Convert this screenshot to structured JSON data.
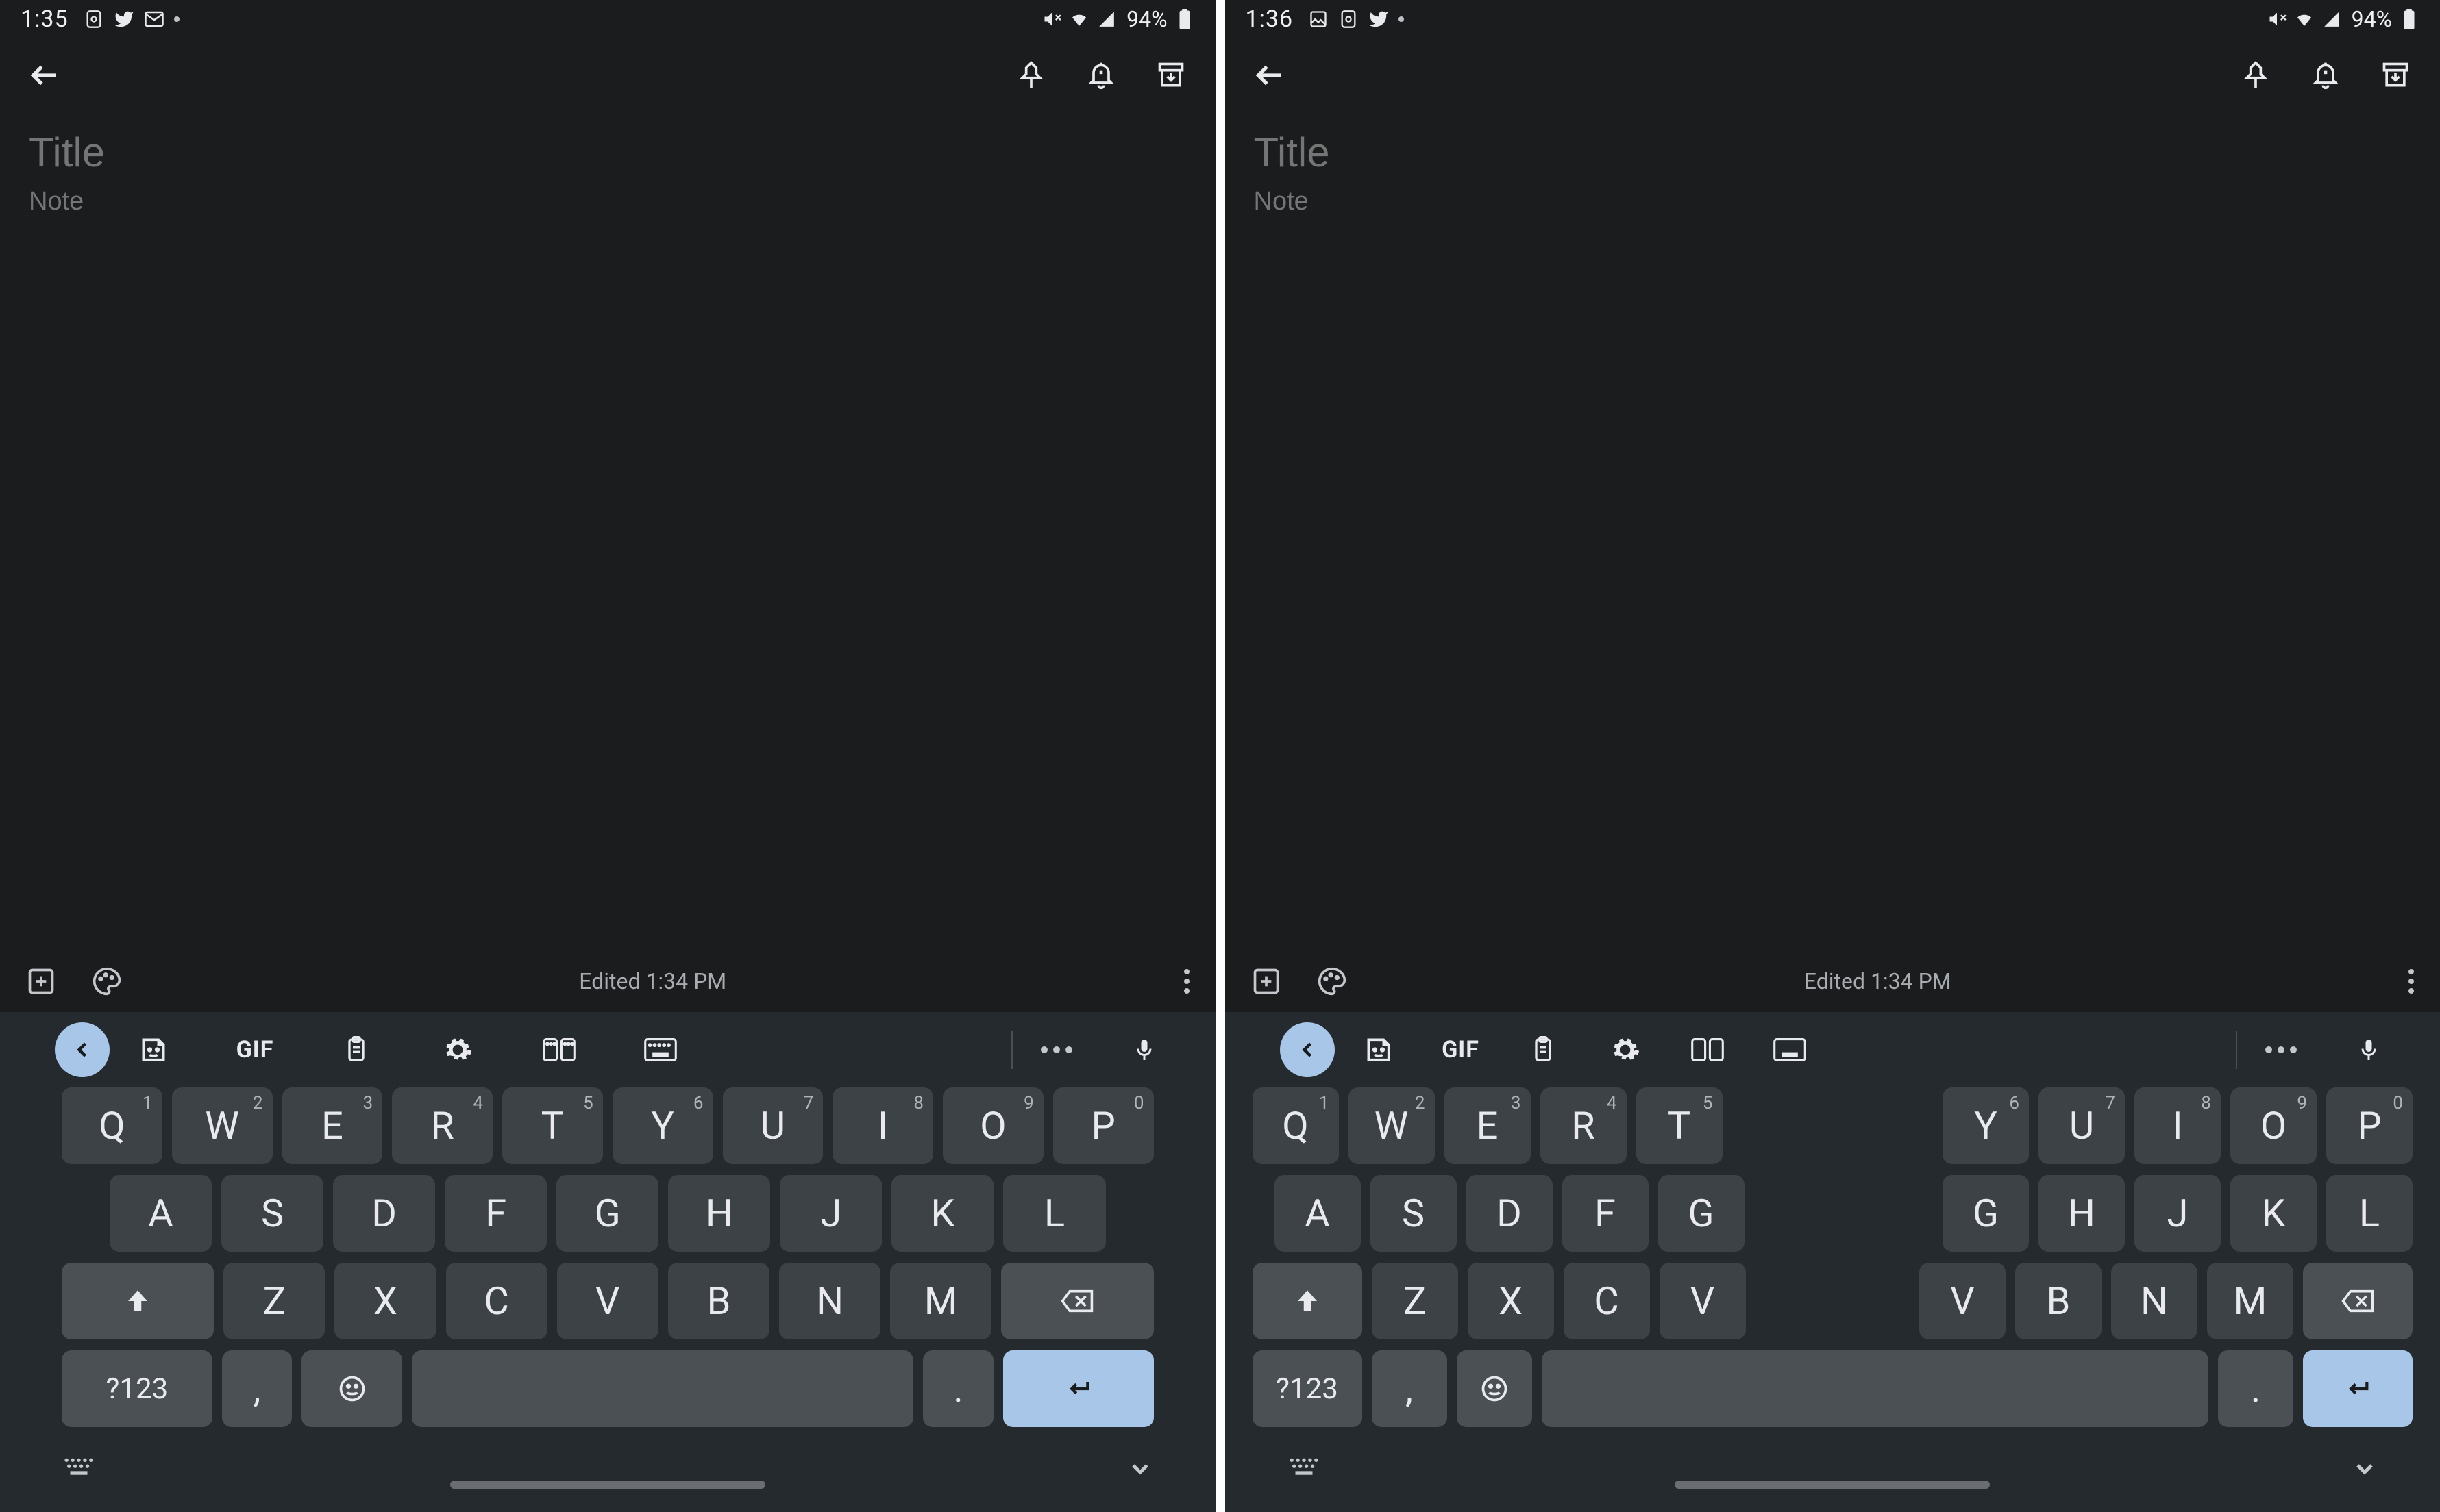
{
  "panes": [
    {
      "status": {
        "time": "1:35",
        "battery": "94%"
      },
      "note": {
        "title_placeholder": "Title",
        "body_placeholder": "Note",
        "edited": "Edited 1:34 PM"
      },
      "keyboard": {
        "layout": "standard",
        "suggest_gif": "GIF",
        "row1": [
          {
            "k": "Q",
            "s": "1"
          },
          {
            "k": "W",
            "s": "2"
          },
          {
            "k": "E",
            "s": "3"
          },
          {
            "k": "R",
            "s": "4"
          },
          {
            "k": "T",
            "s": "5"
          },
          {
            "k": "Y",
            "s": "6"
          },
          {
            "k": "U",
            "s": "7"
          },
          {
            "k": "I",
            "s": "8"
          },
          {
            "k": "O",
            "s": "9"
          },
          {
            "k": "P",
            "s": "0"
          }
        ],
        "row2": [
          "A",
          "S",
          "D",
          "F",
          "G",
          "H",
          "J",
          "K",
          "L"
        ],
        "row3": [
          "Z",
          "X",
          "C",
          "V",
          "B",
          "N",
          "M"
        ],
        "sym_label": "?123",
        "comma": ",",
        "period": "."
      }
    },
    {
      "status": {
        "time": "1:36",
        "battery": "94%"
      },
      "note": {
        "title_placeholder": "Title",
        "body_placeholder": "Note",
        "edited": "Edited 1:34 PM"
      },
      "keyboard": {
        "layout": "split",
        "suggest_gif": "GIF",
        "left": {
          "row1": [
            {
              "k": "Q",
              "s": "1"
            },
            {
              "k": "W",
              "s": "2"
            },
            {
              "k": "E",
              "s": "3"
            },
            {
              "k": "R",
              "s": "4"
            },
            {
              "k": "T",
              "s": "5"
            }
          ],
          "row2": [
            "A",
            "S",
            "D",
            "F",
            "G"
          ],
          "row3": [
            "Z",
            "X",
            "C",
            "V"
          ]
        },
        "right": {
          "row1": [
            {
              "k": "Y",
              "s": "6"
            },
            {
              "k": "U",
              "s": "7"
            },
            {
              "k": "I",
              "s": "8"
            },
            {
              "k": "O",
              "s": "9"
            },
            {
              "k": "P",
              "s": "0"
            }
          ],
          "row2": [
            "G",
            "H",
            "J",
            "K",
            "L"
          ],
          "row3": [
            "V",
            "B",
            "N",
            "M"
          ]
        },
        "sym_label": "?123",
        "comma": ",",
        "period": "."
      }
    }
  ]
}
